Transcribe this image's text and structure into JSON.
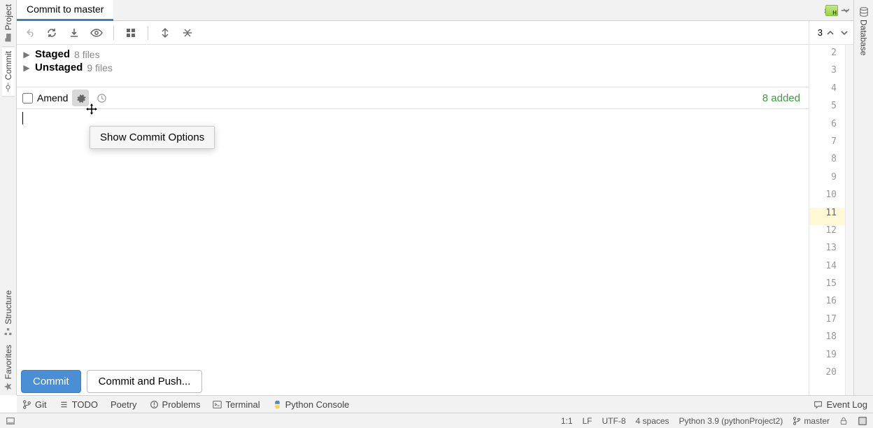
{
  "tab": {
    "title": "Commit to master"
  },
  "toolbar": {
    "nav_text": "3"
  },
  "tree": {
    "staged": {
      "label": "Staged",
      "count": "8 files"
    },
    "unstaged": {
      "label": "Unstaged",
      "count": "9 files"
    }
  },
  "amend": {
    "label": "Amend",
    "added_text": "8 added"
  },
  "tooltip": {
    "text": "Show Commit Options"
  },
  "buttons": {
    "commit": "Commit",
    "commit_push": "Commit and Push..."
  },
  "gutter": {
    "start": 2,
    "end": 20,
    "highlighted": 11
  },
  "left_tabs": {
    "project": "Project",
    "commit": "Commit",
    "structure": "Structure",
    "favorites": "Favorites"
  },
  "right_tabs": {
    "database": "Database"
  },
  "bottom_tabs": {
    "git": "Git",
    "todo": "TODO",
    "poetry": "Poetry",
    "problems": "Problems",
    "terminal": "Terminal",
    "python_console": "Python Console",
    "event_log": "Event Log"
  },
  "status": {
    "pos": "1:1",
    "sep": "LF",
    "enc": "UTF-8",
    "indent": "4 spaces",
    "interpreter": "Python 3.9 (pythonProject2)",
    "branch": "master"
  }
}
